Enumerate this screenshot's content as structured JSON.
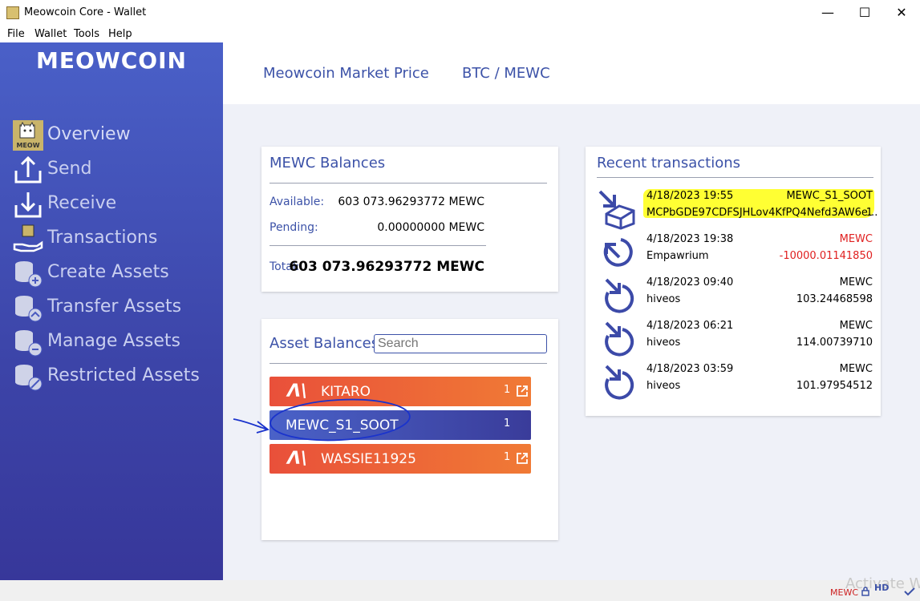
{
  "window": {
    "title": "Meowcoin Core - Wallet",
    "minimize": "—",
    "maximize": "☐",
    "close": "✕"
  },
  "menu": {
    "file": "File",
    "wallet": "Wallet",
    "tools": "Tools",
    "help": "Help"
  },
  "sidebar": {
    "brand": "MEOWCOIN",
    "items": [
      {
        "label": "Overview",
        "icon": "meow-cat-icon"
      },
      {
        "label": "Send",
        "icon": "send-arrow-icon"
      },
      {
        "label": "Receive",
        "icon": "receive-arrow-icon"
      },
      {
        "label": "Transactions",
        "icon": "transactions-hand-icon"
      },
      {
        "label": "Create Assets",
        "icon": "coins-plus-icon"
      },
      {
        "label": "Transfer Assets",
        "icon": "coins-transfer-icon"
      },
      {
        "label": "Manage Assets",
        "icon": "coins-minus-icon"
      },
      {
        "label": "Restricted Assets",
        "icon": "coins-restricted-icon"
      }
    ]
  },
  "topbar": {
    "market_label": "Meowcoin Market Price",
    "pair_label": "BTC / MEWC"
  },
  "balances": {
    "title": "MEWC Balances",
    "available_label": "Available:",
    "available_value": "603 073.96293772 MEWC",
    "pending_label": "Pending:",
    "pending_value": "0.00000000 MEWC",
    "total_label": "Total:",
    "total_value": "603 073.96293772 MEWC"
  },
  "assets": {
    "title": "Asset Balances",
    "search_placeholder": "Search",
    "items": [
      {
        "name": "KITARO",
        "qty": "1",
        "style": "orange",
        "logo": "Λ\\"
      },
      {
        "name": "MEWC_S1_SOOT",
        "qty": "1",
        "style": "blue"
      },
      {
        "name": "WASSIE11925",
        "qty": "1",
        "style": "orange",
        "logo": "Λ\\"
      }
    ]
  },
  "transactions": {
    "title": "Recent transactions",
    "items": [
      {
        "date": "4/18/2023 19:55",
        "unit": "MEWC_S1_SOOT",
        "address": "MCPbGDE97CDFSJHLov4KfPQ4Nefd3AW6e...",
        "amount": "1",
        "direction": "in-asset",
        "highlight": true
      },
      {
        "date": "4/18/2023 19:38",
        "unit": "MEWC",
        "address": "Empawrium",
        "amount": "-10000.01141850",
        "direction": "out",
        "negative": true
      },
      {
        "date": "4/18/2023 09:40",
        "unit": "MEWC",
        "address": "hiveos",
        "amount": "103.24468598",
        "direction": "in"
      },
      {
        "date": "4/18/2023 06:21",
        "unit": "MEWC",
        "address": "hiveos",
        "amount": "114.00739710",
        "direction": "in"
      },
      {
        "date": "4/18/2023 03:59",
        "unit": "MEWC",
        "address": "hiveos",
        "amount": "101.97954512",
        "direction": "in"
      }
    ]
  },
  "statusbar": {
    "unit": "MEWC",
    "hd": "HD",
    "activate": "Activate W"
  },
  "colors": {
    "accent": "#3c52a8",
    "negative": "#e02020",
    "highlight": "#ffff33",
    "orange": "#f07a35"
  }
}
